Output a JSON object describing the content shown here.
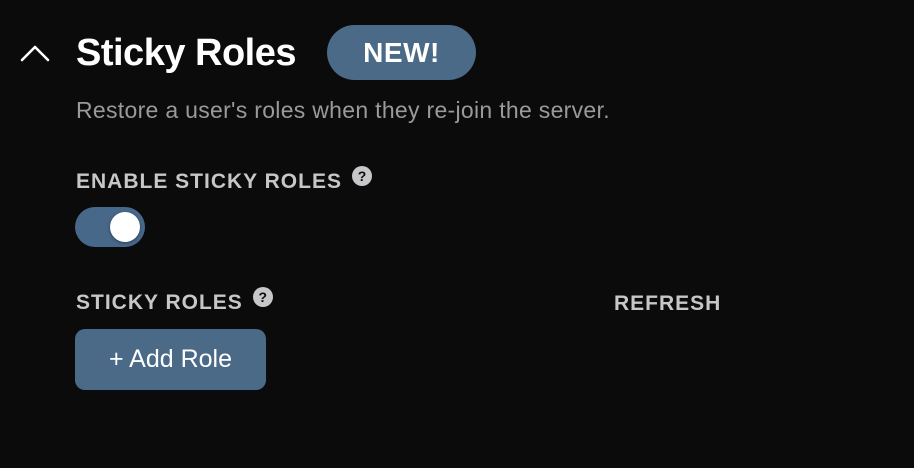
{
  "section": {
    "title": "Sticky Roles",
    "badge": "NEW!",
    "description": "Restore a user's roles when they re-join the server.",
    "collapse_icon": "chevron-up-icon"
  },
  "enable_setting": {
    "label": "ENABLE STICKY ROLES",
    "help_glyph": "?",
    "enabled": true
  },
  "roles_setting": {
    "label": "STICKY ROLES",
    "help_glyph": "?",
    "refresh_label": "REFRESH",
    "add_button_label": "+ Add Role"
  },
  "colors": {
    "background": "#0b0b0c",
    "accent": "#4a6a88",
    "label": "#c7c7c9",
    "description": "#9a9a9c"
  }
}
